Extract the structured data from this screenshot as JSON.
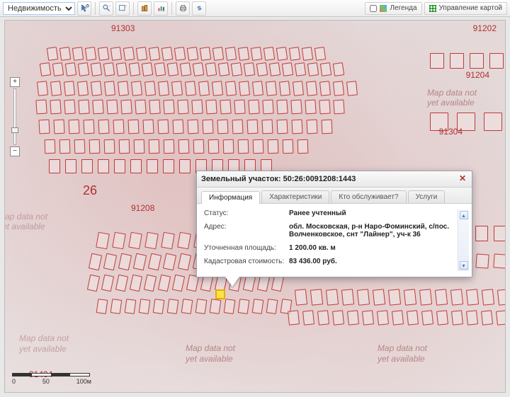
{
  "toolbar": {
    "dropdown_value": "Недвижимость",
    "legend_label": "Легенда",
    "manage_label": "Управление картой"
  },
  "map": {
    "watermark_line1": "Map data not",
    "watermark_line2": "yet available",
    "zone_labels": [
      "91303",
      "91202",
      "91204",
      "91304",
      "91208",
      "91404",
      "26"
    ],
    "scale": {
      "t0": "0",
      "t1": "50",
      "t2": "100м"
    }
  },
  "popup": {
    "title": "Земельный участок: 50:26:0091208:1443",
    "tabs": {
      "info": "Информация",
      "char": "Характеристики",
      "serv": "Кто обслуживает?",
      "uslugi": "Услуги"
    },
    "fields": {
      "status_label": "Статус:",
      "status_value": "Ранее учтенный",
      "address_label": "Адрес:",
      "address_value": "обл. Московская, р-н Наро-Фоминский, с/пос. Волченковское, снт \"Лайнер\", уч-к 36",
      "area_label": "Уточненная площадь:",
      "area_value": "1 200.00 кв. м",
      "cost_label": "Кадастровая стоимость:",
      "cost_value": "83 436.00 руб."
    }
  }
}
